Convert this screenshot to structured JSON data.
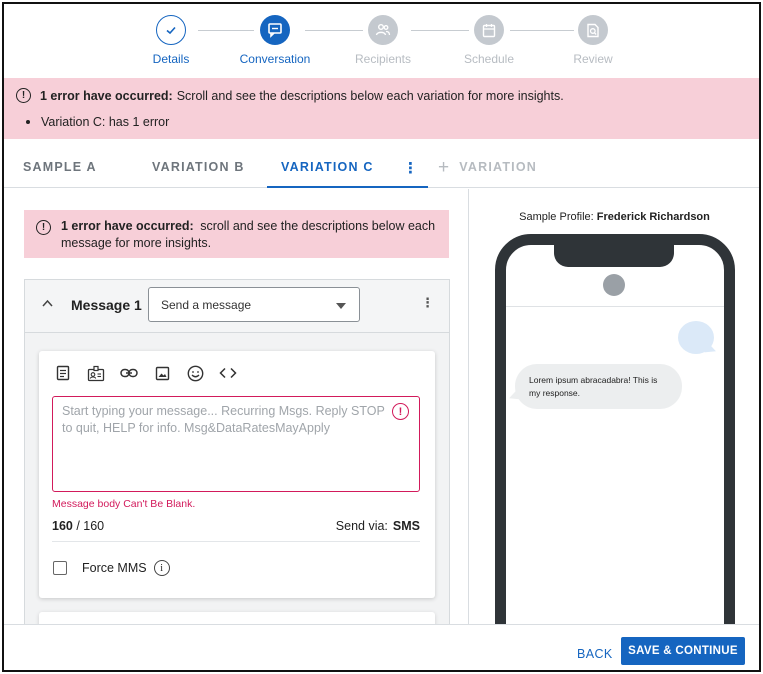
{
  "stepper": {
    "steps": [
      {
        "label": "Details",
        "state": "done",
        "icon": "check-icon"
      },
      {
        "label": "Conversation",
        "state": "active",
        "icon": "chat-icon"
      },
      {
        "label": "Recipients",
        "state": "pending",
        "icon": "people-icon"
      },
      {
        "label": "Schedule",
        "state": "pending",
        "icon": "calendar-icon"
      },
      {
        "label": "Review",
        "state": "pending",
        "icon": "review-icon"
      }
    ]
  },
  "error_banner": {
    "title": "1 error have occurred:",
    "message": "Scroll and see the descriptions below each variation for more insights.",
    "items": [
      "Variation C: has 1 error"
    ]
  },
  "tabs": {
    "items": [
      "SAMPLE A",
      "VARIATION B",
      "VARIATION C"
    ],
    "active": "VARIATION C",
    "add_label": "VARIATION"
  },
  "inner_error": {
    "title": "1 error have occurred:",
    "message": "scroll and see the descriptions below each message for more insights."
  },
  "message": {
    "title": "Message 1",
    "type_select": "Send a message",
    "toolbar_icons": [
      "document-icon",
      "contact-card-icon",
      "link-icon",
      "image-icon",
      "emoji-icon",
      "code-icon"
    ],
    "placeholder": "Start typing your message... Recurring Msgs. Reply STOP to quit, HELP for info. Msg&DataRatesMayApply",
    "value": "",
    "error": "Message body Can't Be Blank.",
    "count": "160",
    "count_total": " / 160",
    "send_via_label": "Send via:",
    "send_via_value": "SMS",
    "force_mms_label": "Force MMS"
  },
  "preview": {
    "sample_profile_label": "Sample Profile:",
    "sample_profile_name": "Frederick Richardson",
    "incoming_text": "Lorem ipsum abracadabra! This is my response."
  },
  "footer": {
    "back_label": "BACK",
    "save_label": "SAVE & CONTINUE"
  },
  "colors": {
    "accent": "#1565c0",
    "error": "#d21a5b",
    "error_bg": "#f7cfd8"
  }
}
